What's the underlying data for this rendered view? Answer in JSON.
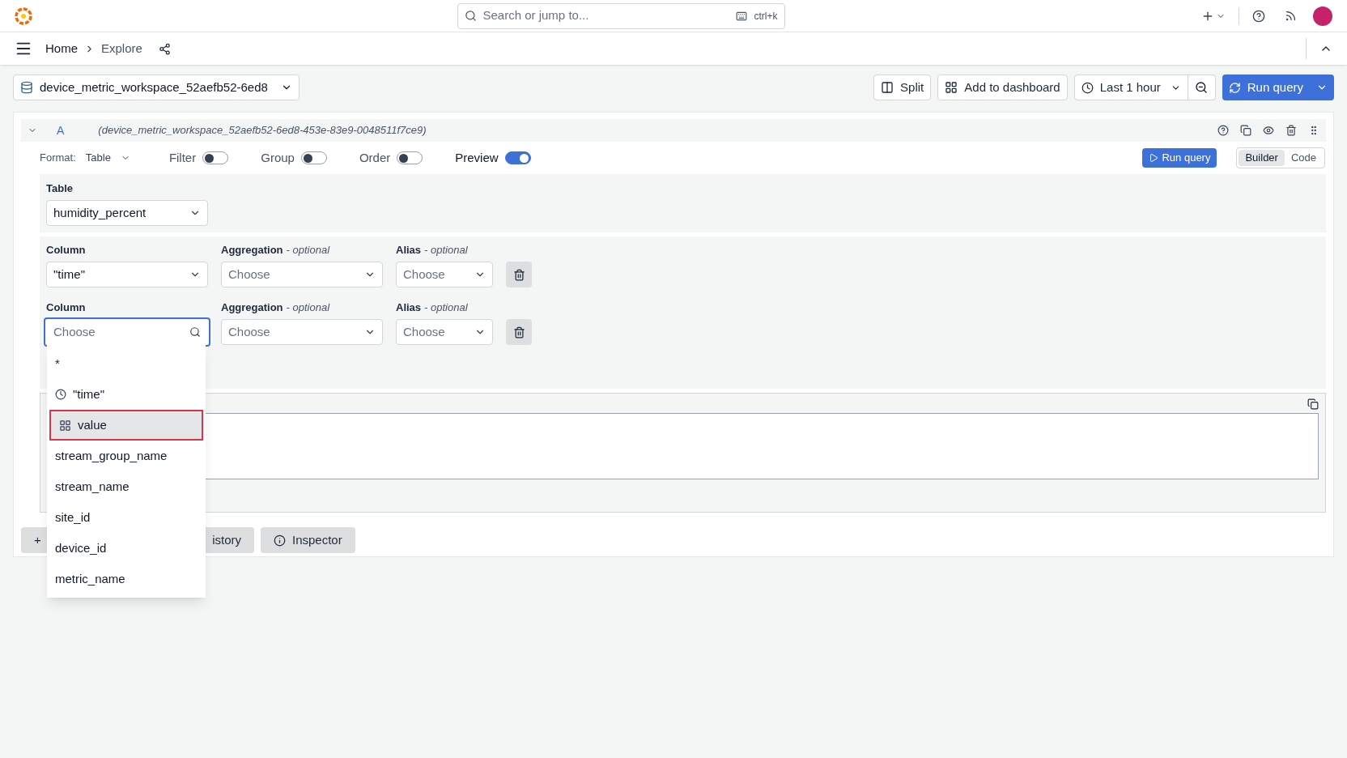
{
  "top_bar": {
    "search": {
      "placeholder": "Search or jump to...",
      "shortcut": "ctrl+k"
    }
  },
  "breadcrumbs": [
    {
      "label": "Home",
      "selected": false
    },
    {
      "label": "Explore",
      "selected": true
    }
  ],
  "toolbar": {
    "datasource": "device_metric_workspace_52aefb52-6ed8",
    "split": "Split",
    "add_to_dashboard": "Add to dashboard",
    "time_range": "Last 1 hour",
    "run_query": "Run query"
  },
  "query": {
    "ref": "A",
    "datasource": "(device_metric_workspace_52aefb52-6ed8-453e-83e9-0048511f7ce9)",
    "format_label": "Format:",
    "format": "Table",
    "toggles": [
      {
        "label": "Filter",
        "on": false
      },
      {
        "label": "Group",
        "on": false
      },
      {
        "label": "Order",
        "on": false
      },
      {
        "label": "Preview",
        "on": true
      }
    ],
    "run_query": "Run query",
    "modes": [
      {
        "label": "Builder",
        "selected": true
      },
      {
        "label": "Code",
        "selected": false
      }
    ],
    "table": {
      "label": "Table",
      "value": "humidity_percent"
    },
    "columns": [
      {
        "column_label": "Column",
        "column_value": "\"time\"",
        "focused": false,
        "aggregation_label": "Aggregation",
        "aggregation_hint": "- optional",
        "aggregation_placeholder": "Choose",
        "alias_label": "Alias",
        "alias_hint": "- optional",
        "alias_placeholder": "Choose"
      },
      {
        "column_label": "Column",
        "column_placeholder": "Choose",
        "focused": true,
        "aggregation_label": "Aggregation",
        "aggregation_hint": "- optional",
        "aggregation_placeholder": "Choose",
        "alias_label": "Alias",
        "alias_hint": "- optional",
        "alias_placeholder": "Choose"
      }
    ],
    "column_options": [
      {
        "label": "*",
        "kind": "plain",
        "selected": false
      },
      {
        "label": "\"time\"",
        "kind": "time",
        "selected": false
      },
      {
        "label": "value",
        "kind": "number",
        "selected": true
      },
      {
        "label": "stream_group_name",
        "kind": "plain",
        "selected": false
      },
      {
        "label": "stream_name",
        "kind": "plain",
        "selected": false
      },
      {
        "label": "site_id",
        "kind": "plain",
        "selected": false
      },
      {
        "label": "device_id",
        "kind": "plain",
        "selected": false
      },
      {
        "label": "metric_name",
        "kind": "plain",
        "selected": false
      }
    ]
  },
  "bottom_buttons": [
    {
      "label": "+",
      "kind": "add"
    },
    {
      "label": "istory",
      "kind": "history"
    },
    {
      "label": "Inspector",
      "kind": "inspector"
    }
  ]
}
